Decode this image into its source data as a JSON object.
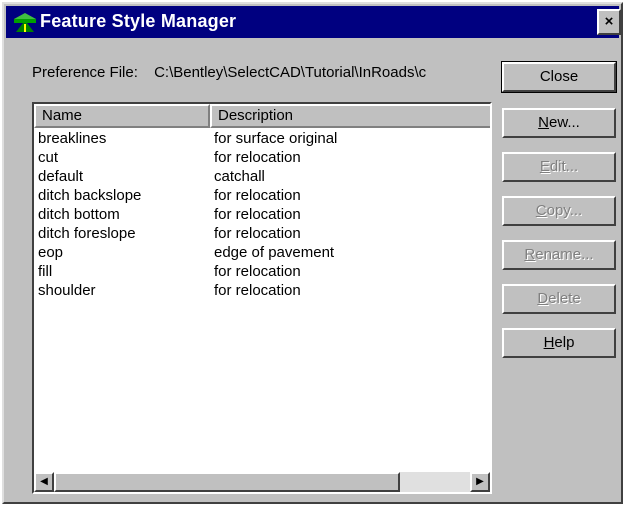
{
  "window": {
    "title": "Feature Style Manager",
    "close_glyph": "×"
  },
  "preference": {
    "label": "Preference File:",
    "path": "C:\\Bentley\\SelectCAD\\Tutorial\\InRoads\\c"
  },
  "list": {
    "columns": [
      "Name",
      "Description"
    ],
    "rows": [
      {
        "name": "breaklines",
        "description": "for surface original"
      },
      {
        "name": "cut",
        "description": "for relocation"
      },
      {
        "name": "default",
        "description": "catchall"
      },
      {
        "name": "ditch backslope",
        "description": "for relocation"
      },
      {
        "name": "ditch bottom",
        "description": "for relocation"
      },
      {
        "name": "ditch foreslope",
        "description": "for relocation"
      },
      {
        "name": "eop",
        "description": "edge of pavement"
      },
      {
        "name": "fill",
        "description": "for relocation"
      },
      {
        "name": "shoulder",
        "description": "for relocation"
      }
    ]
  },
  "buttons": {
    "close": {
      "label": "Close",
      "enabled": true
    },
    "new": {
      "mnemonic": "N",
      "rest": "ew...",
      "enabled": true
    },
    "edit": {
      "mnemonic": "E",
      "rest": "dit...",
      "enabled": false
    },
    "copy": {
      "mnemonic": "C",
      "rest": "opy...",
      "enabled": false
    },
    "rename": {
      "mnemonic": "R",
      "rest": "ename...",
      "enabled": false
    },
    "delete": {
      "mnemonic": "D",
      "rest": "elete",
      "enabled": false
    },
    "help": {
      "mnemonic": "H",
      "rest": "elp",
      "enabled": true
    }
  },
  "icons": {
    "app": "feature-style-app-icon",
    "scroll_left": "◀",
    "scroll_right": "▶"
  },
  "colors": {
    "titlebar": "#000080",
    "face": "#c0c0c0",
    "disabled_text": "#808080"
  }
}
